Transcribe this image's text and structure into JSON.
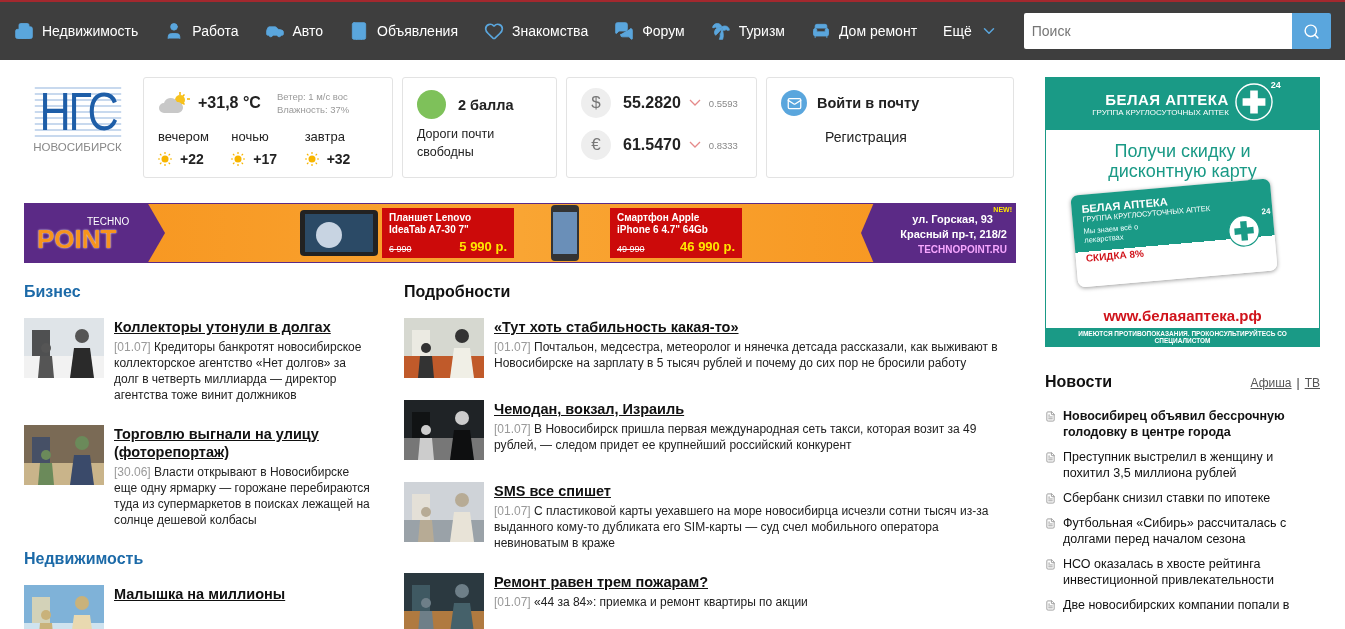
{
  "nav": {
    "items": [
      "Недвижимость",
      "Работа",
      "Авто",
      "Объявления",
      "Знакомства",
      "Форум",
      "Туризм",
      "Дом ремонт"
    ],
    "more": "Ещё",
    "search": {
      "placeholder": "Поиск"
    }
  },
  "logo": {
    "mark": "НГС",
    "city": "НОВОСИБИРСК"
  },
  "weather": {
    "temp": "+31,8 °C",
    "wind": "Ветер: 1 м/с вос",
    "humidity": "Влажность: 37%",
    "forecast": [
      {
        "label": "вечером",
        "temp": "+22"
      },
      {
        "label": "ночью",
        "temp": "+17"
      },
      {
        "label": "завтра",
        "temp": "+32"
      }
    ]
  },
  "traffic": {
    "score": "2 балла",
    "color": "#7ec15a",
    "text": "Дороги почти свободны"
  },
  "rates": [
    {
      "symbol": "$",
      "value": "55.2820",
      "change": "0.5593"
    },
    {
      "symbol": "€",
      "value": "61.5470",
      "change": "0.8333"
    }
  ],
  "mail": {
    "login": "Войти в почту",
    "register": "Регистрация"
  },
  "banner": {
    "brand_top": "TECHNO",
    "brand": "POINT",
    "products": [
      {
        "name": "Планшет Lenovo IdeaTab A7-30 7\"",
        "old_price": "6 990",
        "price": "5 990 р."
      },
      {
        "name": "Смартфон Apple iPhone 6 4.7\" 64Gb",
        "old_price": "49 990",
        "price": "46 990 р."
      }
    ],
    "address": "ул. Горская, 93",
    "badge": "NEW!",
    "address2": "Красный пр-т, 218/2",
    "site": "TECHNOPOINT.RU"
  },
  "sections": [
    {
      "title": "Бизнес",
      "articles": [
        {
          "title": "Коллекторы утонули в долгах",
          "date": "[01.07]",
          "text": "Кредиторы банкротят новосибирское коллекторское агентство «Нет долгов» за долг в четверть миллиарда — директор агентства тоже винит должников"
        },
        {
          "title": "Торговлю выгнали на улицу (фоторепортаж)",
          "date": "[30.06]",
          "text": "Власти открывают в Новосибирске еще одну ярмарку — горожане перебираются туда из супермаркетов в поисках лежащей на солнце дешевой колбасы"
        }
      ]
    },
    {
      "title": "Недвижимость",
      "articles": [
        {
          "title": "Малышка на миллионы"
        }
      ]
    }
  ],
  "details": {
    "title": "Подробности",
    "articles": [
      {
        "title": "«Тут хоть стабильность какая-то»",
        "date": "[01.07]",
        "text": "Почтальон, медсестра, метеоролог и нянечка детсада рассказали, как выживают в Новосибирске на зарплату в 5 тысяч рублей и почему до сих пор не бросили работу"
      },
      {
        "title": "Чемодан, вокзал, Израиль",
        "date": "[01.07]",
        "text": "В Новосибирск пришла первая международная сеть такси, которая возит за 49 рублей, — следом придет ее крупнейший российский конкурент"
      },
      {
        "title": "SMS все спишет",
        "date": "[01.07]",
        "text": "С пластиковой карты уехавшего на море новосибирца исчезли сотни тысяч из-за выданного кому-то дубликата его SIM-карты — суд счел мобильного оператора невиноватым в краже"
      },
      {
        "title": "Ремонт равен трем пожарам?",
        "date": "[01.07]",
        "text": "«44 за 84»: приемка и ремонт квартиры по акции"
      }
    ]
  },
  "ad": {
    "brand": "БЕЛАЯ АПТЕКА",
    "tagline": "ГРУППА КРУГЛОСУТОЧНЫХ АПТЕК",
    "hours": "24",
    "headline": "Получи скидку и дисконтную карту",
    "card_brand": "БЕЛАЯ АПТЕКА",
    "card_tagline": "ГРУППА КРУГЛОСУТОЧНЫХ АПТЕК",
    "card_slogan": "Мы знаем всё о лекарствах",
    "card_hours": "24",
    "discount": "СКИДКА 8%",
    "url": "www.белаяаптека.рф",
    "warning": "ИМЕЮТСЯ ПРОТИВОПОКАЗАНИЯ. ПРОКОНСУЛЬТИРУЙТЕСЬ СО СПЕЦИАЛИСТОМ"
  },
  "news": {
    "title": "Новости",
    "links": [
      "Афиша",
      "ТВ"
    ],
    "separator": "|",
    "items": [
      {
        "text": "Новосибирец объявил бессрочную голодовку в центре города",
        "bold": true
      },
      {
        "text": "Преступник выстрелил в женщину и похитил 3,5 миллиона рублей",
        "bold": false
      },
      {
        "text": "Сбербанк снизил ставки по ипотеке",
        "bold": false
      },
      {
        "text": "Футбольная «Сибирь» рассчиталась с долгами перед началом сезона",
        "bold": false
      },
      {
        "text": "НСО оказалась в хвосте рейтинга инвестиционной привлекательности",
        "bold": false
      },
      {
        "text": "Две новосибирских компании попали в",
        "bold": false
      }
    ]
  }
}
